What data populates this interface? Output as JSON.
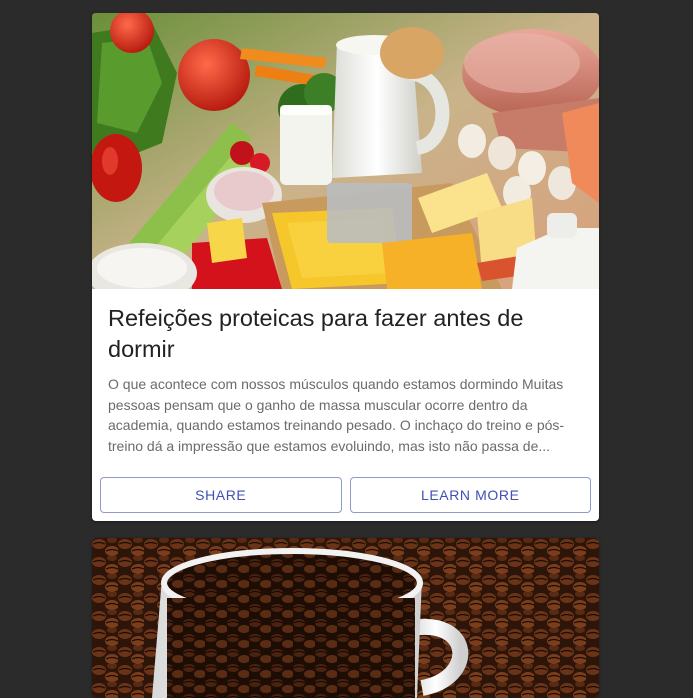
{
  "cards": [
    {
      "image_alt": "food-photo",
      "title": "Refeições proteicas para fazer antes de dormir",
      "body": "O que acontece com nossos músculos quando estamos dormindo Muitas pessoas pensam que o ganho de massa muscular ocorre dentro da academia, quando estamos treinando pesado. O inchaço do treino e pós-treino dá a impressão que estamos evoluindo, mas isto não passa de...",
      "share_label": "SHARE",
      "learn_more_label": "LEARN MORE"
    },
    {
      "image_alt": "coffee-photo"
    }
  ],
  "colors": {
    "page_background": "#2b2b2b",
    "card_background": "#ffffff",
    "button_text": "#3f51b5",
    "button_border": "#8f9ac9"
  }
}
